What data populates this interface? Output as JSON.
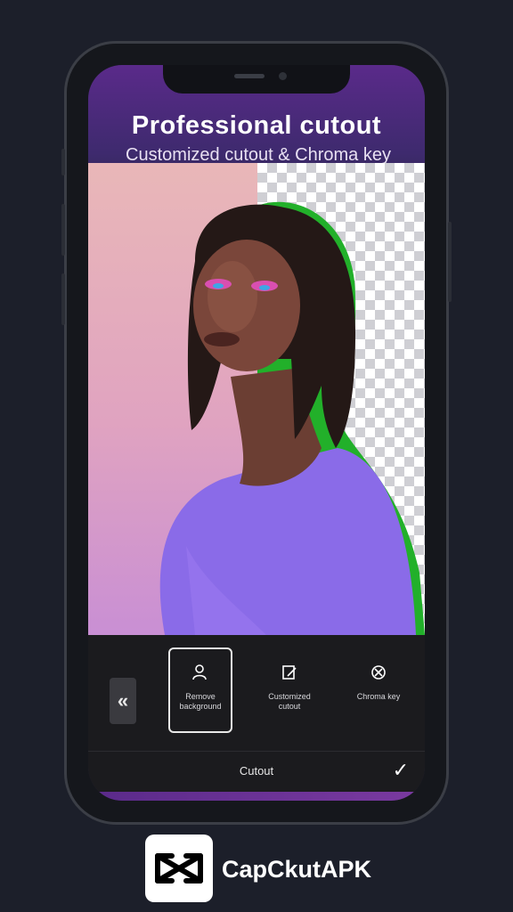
{
  "promo": {
    "headline": "Professional cutout",
    "subheadline": "Customized cutout & Chroma key"
  },
  "toolbar": {
    "collapse_icon": "chevrons-left-icon",
    "tools": [
      {
        "label": "Remove background",
        "icon": "person-remove-icon",
        "selected": true
      },
      {
        "label": "Customized cutout",
        "icon": "brush-cutout-icon",
        "selected": false
      },
      {
        "label": "Chroma key",
        "icon": "chroma-key-icon",
        "selected": false
      }
    ]
  },
  "bottom_bar": {
    "title": "Cutout",
    "confirm_icon": "check-icon"
  },
  "brand": {
    "name": "CapCkutAPK",
    "logo_icon": "capcut-logo-icon"
  },
  "colors": {
    "outline_green": "#22b02a",
    "shirt_purple": "#8a6be8",
    "accent_purple": "#5a2a8a"
  }
}
